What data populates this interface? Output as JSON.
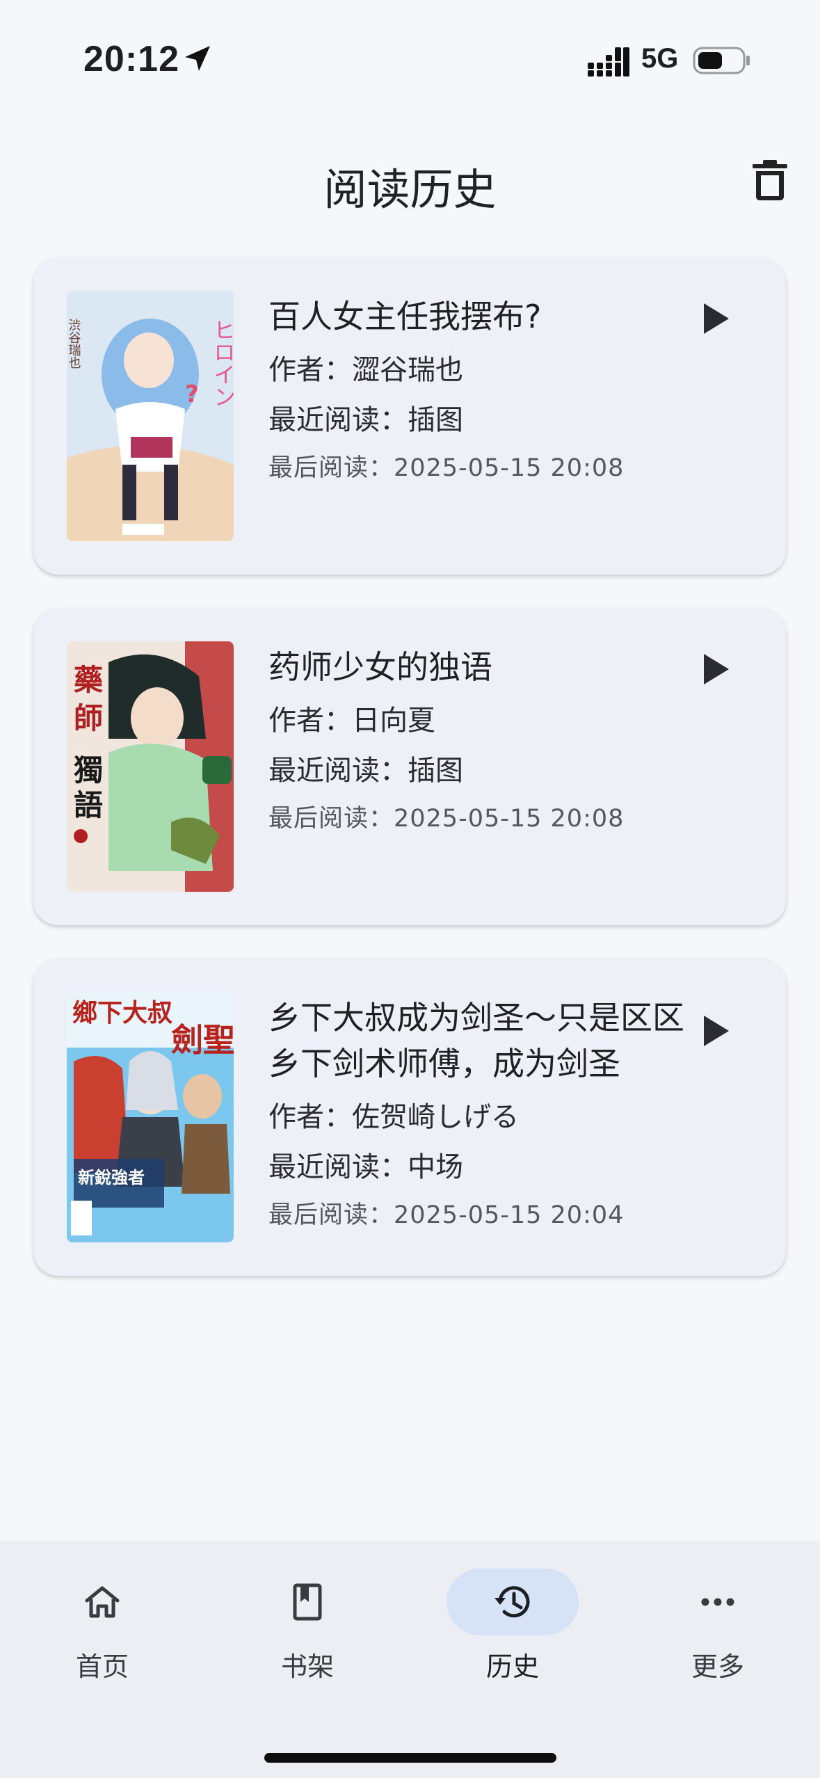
{
  "status_bar": {
    "time": "20:12",
    "network": "5G"
  },
  "header": {
    "title": "阅读历史",
    "clear_icon": "trash-icon"
  },
  "history": [
    {
      "title": "百人女主任我摆布?",
      "author": "作者：澀谷瑞也",
      "recent_chapter": "最近阅读：插图",
      "last_read": "最后阅读：2025-05-15 20:08",
      "cover_colors": [
        "#cfe1f2",
        "#7fb3e6",
        "#f4c9d4"
      ]
    },
    {
      "title": "药师少女的独语",
      "author": "作者：日向夏",
      "recent_chapter": "最近阅读：插图",
      "last_read": "最后阅读：2025-05-15 20:08",
      "cover_colors": [
        "#f1e9e0",
        "#a8d8a2",
        "#b43a3a"
      ]
    },
    {
      "title": "乡下大叔成为剑圣～只是区区乡下剑术师傅，成为剑圣",
      "author": "作者：佐贺崎しげる",
      "recent_chapter": "最近阅读：中场",
      "last_read": "最后阅读：2025-05-15 20:04",
      "cover_colors": [
        "#5ab7e6",
        "#c94030",
        "#3a3f4a"
      ]
    }
  ],
  "bottom_nav": [
    {
      "label": "首页",
      "icon": "home-icon",
      "active": false
    },
    {
      "label": "书架",
      "icon": "bookmark-book-icon",
      "active": false
    },
    {
      "label": "历史",
      "icon": "history-icon",
      "active": true
    },
    {
      "label": "更多",
      "icon": "more-icon",
      "active": false
    }
  ],
  "colors": {
    "background": "#f6f7fb",
    "card": "#eef0f7",
    "active_nav_pill": "#d6e3f7"
  }
}
